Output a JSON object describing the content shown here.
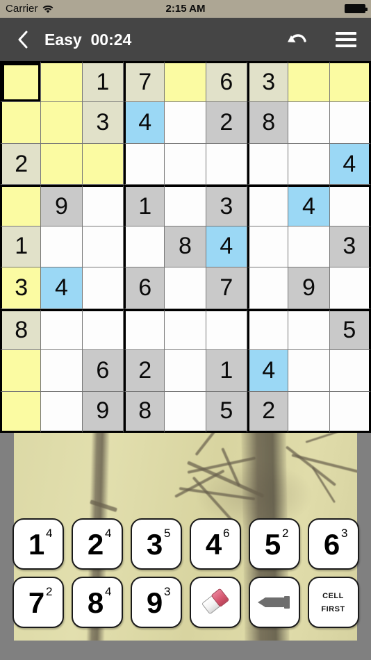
{
  "statusbar": {
    "carrier": "Carrier",
    "wifi_icon": "wifi-icon",
    "time": "2:15 AM",
    "battery_icon": "battery-full-icon"
  },
  "navbar": {
    "back_icon": "chevron-left-icon",
    "title": "Easy  00:24",
    "difficulty": "Easy",
    "timer": "00:24",
    "undo_icon": "undo-arrow-icon",
    "menu_icon": "hamburger-menu-icon"
  },
  "colors": {
    "status_bg": "#ada694",
    "nav_bg": "#454545",
    "cell_white": "#fdfdfd",
    "cell_yellow": "#fbfba2",
    "cell_beige": "#e1e1c9",
    "cell_gray": "#c9c9c9",
    "cell_blue": "#9bd8f5",
    "page_bg": "#808080",
    "key_face": "#ffffff",
    "eraser_tip": "#d4566f",
    "marker_gray": "#6e6e6e"
  },
  "board": {
    "selected": {
      "row": 0,
      "col": 0
    },
    "cells": [
      [
        {
          "v": "",
          "s": "yellow"
        },
        {
          "v": "",
          "s": "yellow"
        },
        {
          "v": "1",
          "s": "beige"
        },
        {
          "v": "7",
          "s": "beige"
        },
        {
          "v": "",
          "s": "yellow"
        },
        {
          "v": "6",
          "s": "beige"
        },
        {
          "v": "3",
          "s": "beige"
        },
        {
          "v": "",
          "s": "yellow"
        },
        {
          "v": "",
          "s": "yellow"
        }
      ],
      [
        {
          "v": "",
          "s": "yellow"
        },
        {
          "v": "",
          "s": "yellow"
        },
        {
          "v": "3",
          "s": "beige"
        },
        {
          "v": "4",
          "s": "blue"
        },
        {
          "v": "",
          "s": "white"
        },
        {
          "v": "2",
          "s": "gray"
        },
        {
          "v": "8",
          "s": "gray"
        },
        {
          "v": "",
          "s": "white"
        },
        {
          "v": "",
          "s": "white"
        }
      ],
      [
        {
          "v": "2",
          "s": "beige"
        },
        {
          "v": "",
          "s": "yellow"
        },
        {
          "v": "",
          "s": "yellow"
        },
        {
          "v": "",
          "s": "white"
        },
        {
          "v": "",
          "s": "white"
        },
        {
          "v": "",
          "s": "white"
        },
        {
          "v": "",
          "s": "white"
        },
        {
          "v": "",
          "s": "white"
        },
        {
          "v": "4",
          "s": "blue"
        }
      ],
      [
        {
          "v": "",
          "s": "yellow"
        },
        {
          "v": "9",
          "s": "gray"
        },
        {
          "v": "",
          "s": "white"
        },
        {
          "v": "1",
          "s": "gray"
        },
        {
          "v": "",
          "s": "white"
        },
        {
          "v": "3",
          "s": "gray"
        },
        {
          "v": "",
          "s": "white"
        },
        {
          "v": "4",
          "s": "blue"
        },
        {
          "v": "",
          "s": "white"
        }
      ],
      [
        {
          "v": "1",
          "s": "beige"
        },
        {
          "v": "",
          "s": "white"
        },
        {
          "v": "",
          "s": "white"
        },
        {
          "v": "",
          "s": "white"
        },
        {
          "v": "8",
          "s": "gray"
        },
        {
          "v": "4",
          "s": "blue"
        },
        {
          "v": "",
          "s": "white"
        },
        {
          "v": "",
          "s": "white"
        },
        {
          "v": "3",
          "s": "gray"
        }
      ],
      [
        {
          "v": "3",
          "s": "yellow"
        },
        {
          "v": "4",
          "s": "blue"
        },
        {
          "v": "",
          "s": "white"
        },
        {
          "v": "6",
          "s": "gray"
        },
        {
          "v": "",
          "s": "white"
        },
        {
          "v": "7",
          "s": "gray"
        },
        {
          "v": "",
          "s": "white"
        },
        {
          "v": "9",
          "s": "gray"
        },
        {
          "v": "",
          "s": "white"
        }
      ],
      [
        {
          "v": "8",
          "s": "beige"
        },
        {
          "v": "",
          "s": "white"
        },
        {
          "v": "",
          "s": "white"
        },
        {
          "v": "",
          "s": "white"
        },
        {
          "v": "",
          "s": "white"
        },
        {
          "v": "",
          "s": "white"
        },
        {
          "v": "",
          "s": "white"
        },
        {
          "v": "",
          "s": "white"
        },
        {
          "v": "5",
          "s": "gray"
        }
      ],
      [
        {
          "v": "",
          "s": "yellow"
        },
        {
          "v": "",
          "s": "white"
        },
        {
          "v": "6",
          "s": "gray"
        },
        {
          "v": "2",
          "s": "gray"
        },
        {
          "v": "",
          "s": "white"
        },
        {
          "v": "1",
          "s": "gray"
        },
        {
          "v": "4",
          "s": "blue"
        },
        {
          "v": "",
          "s": "white"
        },
        {
          "v": "",
          "s": "white"
        }
      ],
      [
        {
          "v": "",
          "s": "yellow"
        },
        {
          "v": "",
          "s": "white"
        },
        {
          "v": "9",
          "s": "gray"
        },
        {
          "v": "8",
          "s": "gray"
        },
        {
          "v": "",
          "s": "white"
        },
        {
          "v": "5",
          "s": "gray"
        },
        {
          "v": "2",
          "s": "gray"
        },
        {
          "v": "",
          "s": "white"
        },
        {
          "v": "",
          "s": "white"
        }
      ]
    ]
  },
  "keypad": {
    "rows": [
      [
        {
          "type": "digit",
          "label": "1",
          "count": "4",
          "name": "key-1"
        },
        {
          "type": "digit",
          "label": "2",
          "count": "4",
          "name": "key-2"
        },
        {
          "type": "digit",
          "label": "3",
          "count": "5",
          "name": "key-3"
        },
        {
          "type": "digit",
          "label": "4",
          "count": "6",
          "name": "key-4"
        },
        {
          "type": "digit",
          "label": "5",
          "count": "2",
          "name": "key-5"
        },
        {
          "type": "digit",
          "label": "6",
          "count": "3",
          "name": "key-6"
        }
      ],
      [
        {
          "type": "digit",
          "label": "7",
          "count": "2",
          "name": "key-7"
        },
        {
          "type": "digit",
          "label": "8",
          "count": "4",
          "name": "key-8"
        },
        {
          "type": "digit",
          "label": "9",
          "count": "3",
          "name": "key-9"
        },
        {
          "type": "eraser",
          "label": "",
          "count": "",
          "name": "key-eraser"
        },
        {
          "type": "marker",
          "label": "",
          "count": "",
          "name": "key-pencil-mark"
        },
        {
          "type": "text",
          "label": "Cell First",
          "line1": "Cell",
          "line2": "First",
          "count": "",
          "name": "key-cell-first"
        }
      ]
    ]
  }
}
